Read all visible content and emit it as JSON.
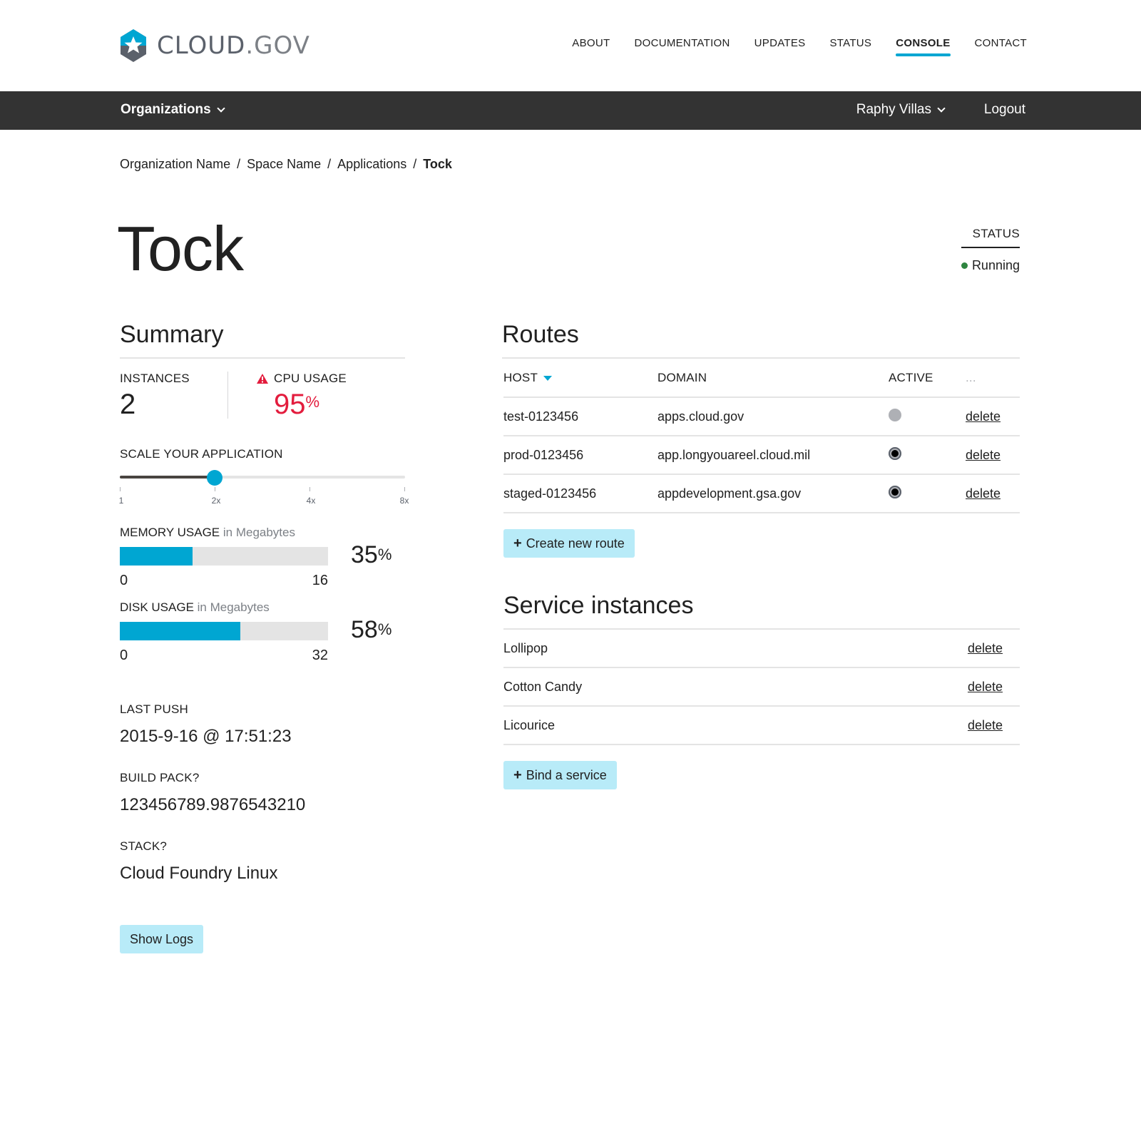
{
  "brand": {
    "name_main": "CLOUD",
    "name_suffix": ".GOV",
    "accent": "#00a6d2",
    "icon": "star-hexagon-icon"
  },
  "topnav": {
    "items": [
      "ABOUT",
      "DOCUMENTATION",
      "UPDATES",
      "STATUS",
      "CONSOLE",
      "CONTACT"
    ],
    "active": "CONSOLE"
  },
  "subbar": {
    "organizations": "Organizations",
    "user": "Raphy Villas",
    "logout": "Logout"
  },
  "breadcrumb": {
    "org": "Organization Name",
    "space": "Space Name",
    "apps": "Applications",
    "current": "Tock",
    "separator": "/"
  },
  "app": {
    "name": "Tock",
    "status_label": "STATUS",
    "status_value": "Running",
    "status_color": "#2e8540"
  },
  "summary": {
    "title": "Summary",
    "instances_label": "INSTANCES",
    "instances_value": "2",
    "cpu_label": "CPU USAGE",
    "cpu_value": "95",
    "cpu_unit": "%",
    "cpu_color": "#e31c3d",
    "scale_label": "SCALE YOUR APPLICATION",
    "scale_ticks": [
      "1",
      "2x",
      "4x",
      "8x"
    ],
    "scale_selected": "2x",
    "memory": {
      "label": "MEMORY USAGE",
      "unit": "in Megabytes",
      "min": "0",
      "max": "16",
      "percent": "35",
      "percent_unit": "%",
      "fraction": 0.35
    },
    "disk": {
      "label": "DISK USAGE",
      "unit": "in Megabytes",
      "min": "0",
      "max": "32",
      "percent": "58",
      "percent_unit": "%",
      "fraction": 0.58
    },
    "last_push_label": "LAST PUSH",
    "last_push_value": "2015-9-16 @ 17:51:23",
    "build_pack_label": "BUILD PACK?",
    "build_pack_value": "123456789.9876543210",
    "stack_label": "STACK?",
    "stack_value": "Cloud Foundry Linux",
    "show_logs": "Show Logs"
  },
  "routes": {
    "title": "Routes",
    "headers": {
      "host": "HOST",
      "domain": "DOMAIN",
      "active": "ACTIVE",
      "more": "..."
    },
    "rows": [
      {
        "host": "test-0123456",
        "domain": "apps.cloud.gov",
        "active": false,
        "action": "delete"
      },
      {
        "host": "prod-0123456",
        "domain": "app.longyouareel.cloud.mil",
        "active": true,
        "action": "delete"
      },
      {
        "host": "staged-0123456",
        "domain": "appdevelopment.gsa.gov",
        "active": true,
        "action": "delete"
      }
    ],
    "create_label": "Create new route"
  },
  "services": {
    "title": "Service instances",
    "rows": [
      {
        "name": "Lollipop",
        "action": "delete"
      },
      {
        "name": "Cotton Candy",
        "action": "delete"
      },
      {
        "name": "Licourice",
        "action": "delete"
      }
    ],
    "bind_label": "Bind a service"
  }
}
